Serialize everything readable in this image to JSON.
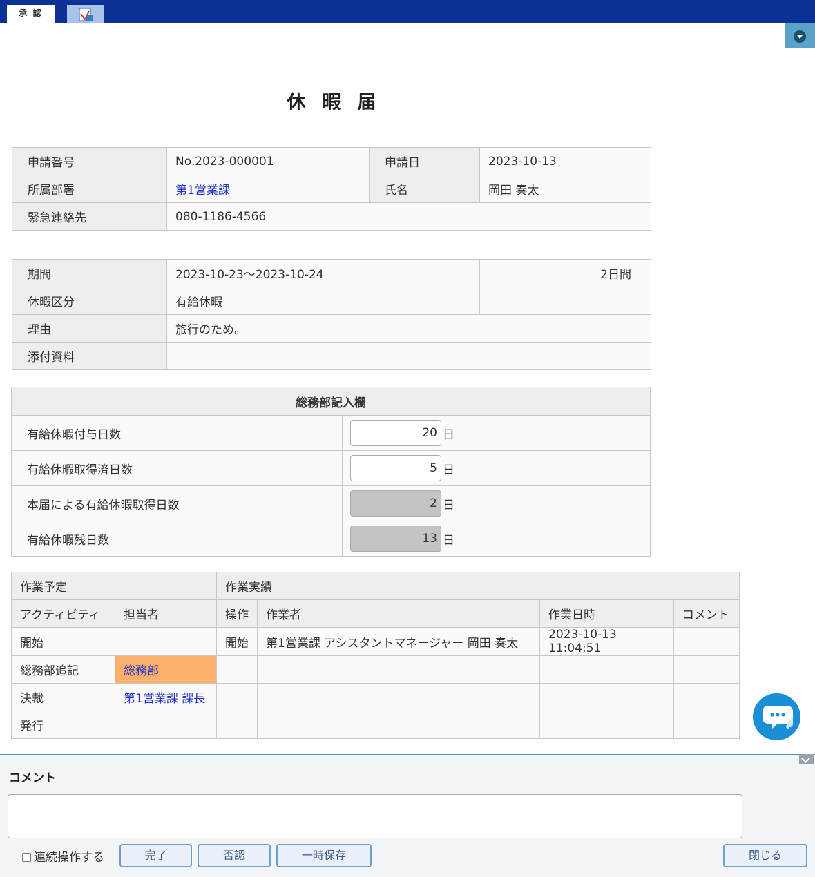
{
  "tabs": {
    "approve": "承 認",
    "pdf_icon": "pdf-icon"
  },
  "title": "休暇届",
  "application": {
    "number_label": "申請番号",
    "number": "No.2023-000001",
    "date_label": "申請日",
    "date": "2023-10-13",
    "dept_label": "所属部署",
    "dept": "第1営業課",
    "name_label": "氏名",
    "name": "岡田 奏太",
    "emergency_label": "緊急連絡先",
    "emergency": "080-1186-4566"
  },
  "leave": {
    "period_label": "期間",
    "period": "2023-10-23～2023-10-24",
    "days": "2日間",
    "type_label": "休暇区分",
    "type": "有給休暇",
    "reason_label": "理由",
    "reason": "旅行のため。",
    "attachment_label": "添付資料"
  },
  "admin": {
    "header": "総務部記入欄",
    "unit": "日",
    "rows": [
      {
        "label": "有給休暇付与日数",
        "value": "20"
      },
      {
        "label": "有給休暇取得済日数",
        "value": "5"
      },
      {
        "label": "本届による有給休暇取得日数",
        "value": "2"
      },
      {
        "label": "有給休暇残日数",
        "value": "13"
      }
    ]
  },
  "workflow": {
    "plan_header": "作業予定",
    "actual_header": "作業実績",
    "col_activity": "アクティビティ",
    "col_assignee": "担当者",
    "col_operation": "操作",
    "col_worker": "作業者",
    "col_datetime": "作業日時",
    "col_comment": "コメント",
    "rows": [
      {
        "activity": "開始",
        "assignee": "",
        "operation": "開始",
        "worker": "第1営業課 アシスタントマネージャー 岡田 奏太",
        "datetime": "2023-10-13 11:04:51"
      },
      {
        "activity": "総務部追記",
        "assignee": "総務部"
      },
      {
        "activity": "決裁",
        "assignee": "第1営業課 課長"
      },
      {
        "activity": "発行",
        "assignee": ""
      }
    ]
  },
  "comment": {
    "label": "コメント",
    "continuous": "連続操作する",
    "buttons": {
      "complete": "完了",
      "reject": "否認",
      "save": "一時保存",
      "close": "閉じる"
    }
  },
  "colors": {
    "topbar": "#0a3196",
    "highlight": "#fbb06c",
    "link": "#2233cc"
  }
}
